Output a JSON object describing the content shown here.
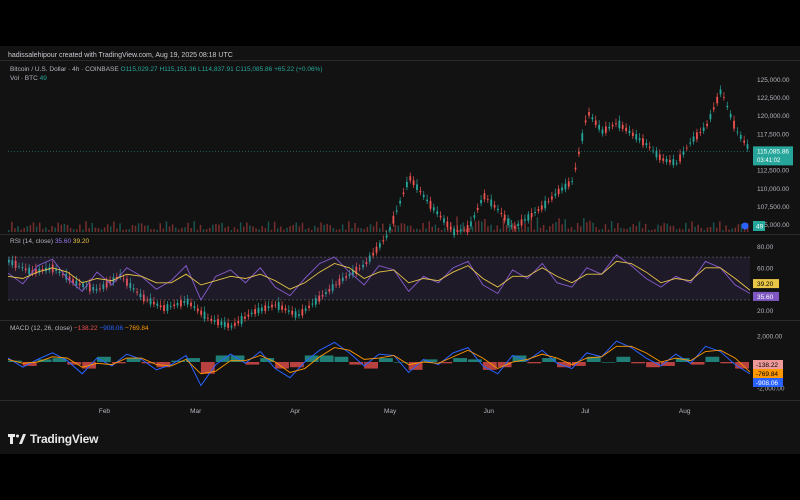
{
  "header": {
    "credit": "hadissalehipour created with TradingView.com, Aug 19, 2025 08:18 UTC"
  },
  "legend": {
    "symbol": "Bitcoin / U.S. Dollar · 4h · COINBASE",
    "open": "O115,029.27",
    "high": "H115,151.36",
    "low": "L114,837.91",
    "close": "C115,085.86",
    "change": "+65.22 (+0.06%)",
    "vol_label": "Vol · BTC",
    "vol_value": "49"
  },
  "rsi_legend": {
    "label": "RSI (14, close)",
    "v1": "35.60",
    "v2": "39.20"
  },
  "macd_legend": {
    "label": "MACD (12, 26, close)",
    "hist": "−138.22",
    "macd": "−908.06",
    "signal": "−769.84"
  },
  "brand": {
    "name": "TradingView"
  },
  "colors": {
    "up": "#26a69a",
    "down": "#ef5350",
    "rsi": "#7e57c2",
    "rsi_ma": "#e8c547",
    "macd": "#2962ff",
    "signal": "#ff9800",
    "price_line": "#26a69a"
  },
  "chart_data": {
    "type": "line",
    "price_axis": {
      "ticks": [
        "125,000.00",
        "122,500.00",
        "120,000.00",
        "117,500.00",
        "115,000.00",
        "112,500.00",
        "110,000.00",
        "107,500.00",
        "105,000.00"
      ],
      "ylim": [
        104000,
        126000
      ],
      "last_price": "115,085.86",
      "countdown": "03:41:02",
      "vol_badge": "49"
    },
    "x_ticks": [
      "Feb",
      "Mar",
      "Apr",
      "May",
      "Jun",
      "Jul",
      "Aug"
    ],
    "price_series": {
      "name": "BTC/USD",
      "x": [
        0,
        3,
        6,
        9,
        12,
        15,
        18,
        21,
        24,
        27,
        30,
        33,
        36,
        39,
        42,
        45,
        48,
        51,
        54,
        57,
        60,
        62,
        64,
        66,
        68,
        70,
        72,
        74,
        76,
        78,
        80,
        82,
        84,
        86,
        88,
        90,
        92,
        94,
        96,
        98,
        100
      ],
      "values": [
        100000,
        98500,
        99000,
        97000,
        96000,
        98000,
        95000,
        93500,
        94500,
        92000,
        91000,
        93000,
        94000,
        92500,
        95000,
        97500,
        99500,
        103500,
        111500,
        107500,
        104000,
        104500,
        109000,
        107000,
        104500,
        106000,
        107500,
        109500,
        111000,
        120500,
        117800,
        119000,
        117500,
        116000,
        114000,
        113500,
        116500,
        118500,
        123500,
        118000,
        115100
      ]
    },
    "rsi": {
      "ticks": [
        "80.00",
        "60.00",
        "20.00"
      ],
      "ylim": [
        15,
        85
      ],
      "badges": [
        "39.20",
        "35.60"
      ],
      "x": [
        0,
        2,
        4,
        6,
        8,
        10,
        12,
        14,
        16,
        18,
        20,
        22,
        24,
        26,
        28,
        30,
        32,
        34,
        36,
        38,
        40,
        42,
        44,
        46,
        48,
        50,
        52,
        54,
        56,
        58,
        60,
        62,
        64,
        66,
        68,
        70,
        72,
        74,
        76,
        78,
        80,
        82,
        84,
        86,
        88,
        90,
        92,
        94,
        96,
        98,
        100
      ],
      "values": [
        55,
        45,
        62,
        68,
        50,
        38,
        56,
        44,
        60,
        52,
        40,
        48,
        62,
        30,
        52,
        58,
        46,
        60,
        42,
        34,
        50,
        64,
        70,
        56,
        44,
        62,
        58,
        38,
        52,
        46,
        60,
        66,
        44,
        36,
        58,
        50,
        64,
        46,
        42,
        60,
        54,
        72,
        62,
        50,
        42,
        52,
        46,
        66,
        60,
        44,
        36
      ],
      "ma": [
        52,
        50,
        56,
        60,
        56,
        46,
        50,
        48,
        54,
        52,
        46,
        46,
        54,
        44,
        48,
        52,
        50,
        54,
        48,
        40,
        46,
        56,
        64,
        60,
        50,
        56,
        58,
        46,
        50,
        48,
        56,
        62,
        50,
        42,
        52,
        52,
        60,
        52,
        46,
        54,
        54,
        66,
        64,
        56,
        46,
        50,
        48,
        60,
        60,
        50,
        39
      ]
    },
    "macd": {
      "ticks": [
        "2,000.00",
        "-2,000.00"
      ],
      "ylim": [
        -2600,
        2600
      ],
      "badges": [
        "-138.22",
        "-769.84",
        "-908.06"
      ],
      "x": [
        0,
        2,
        4,
        6,
        8,
        10,
        12,
        14,
        16,
        18,
        20,
        22,
        24,
        26,
        28,
        30,
        32,
        34,
        36,
        38,
        40,
        42,
        44,
        46,
        48,
        50,
        52,
        54,
        56,
        58,
        60,
        62,
        64,
        66,
        68,
        70,
        72,
        74,
        76,
        78,
        80,
        82,
        84,
        86,
        88,
        90,
        92,
        94,
        96,
        98,
        100
      ],
      "macd_line": [
        300,
        -400,
        200,
        700,
        100,
        -900,
        300,
        -300,
        600,
        200,
        -600,
        -200,
        500,
        -1800,
        -200,
        600,
        -100,
        800,
        -500,
        -1200,
        0,
        900,
        1500,
        700,
        -300,
        600,
        500,
        -800,
        200,
        -200,
        700,
        1100,
        -300,
        -900,
        500,
        100,
        900,
        -100,
        -500,
        700,
        400,
        1600,
        1100,
        300,
        -300,
        600,
        -100,
        1200,
        800,
        -200,
        -908
      ],
      "signal_line": [
        200,
        -100,
        0,
        400,
        300,
        -400,
        -100,
        -200,
        300,
        300,
        -200,
        -300,
        200,
        -900,
        -700,
        100,
        100,
        500,
        0,
        -800,
        -500,
        400,
        1100,
        900,
        200,
        300,
        500,
        -200,
        0,
        -100,
        400,
        900,
        300,
        -500,
        0,
        200,
        600,
        300,
        -200,
        300,
        400,
        1200,
        1200,
        700,
        0,
        300,
        100,
        800,
        900,
        300,
        -770
      ]
    },
    "title": "",
    "xlabel": "",
    "ylabel": ""
  }
}
